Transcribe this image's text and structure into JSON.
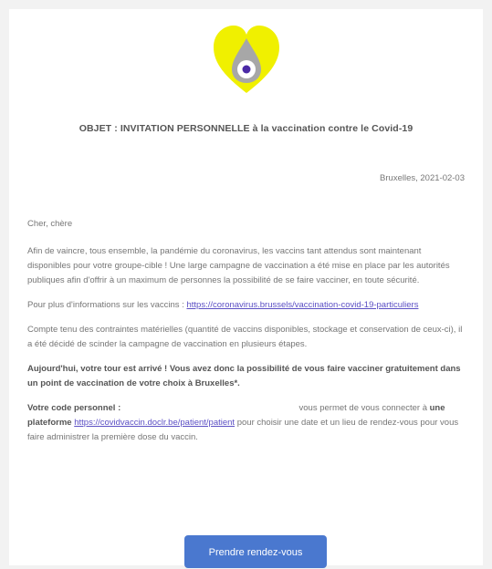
{
  "email": {
    "subject": "OBJET : INVITATION PERSONNELLE à la vaccination contre le Covid-19",
    "date": "Bruxelles, 2021-02-03",
    "greeting": "Cher, chère",
    "paragraph1": "Afin de vaincre, tous ensemble, la pandémie du coronavirus, les vaccins tant attendus sont maintenant disponibles pour votre groupe-cible ! Une large campagne de vaccination a été mise en place par les autorités publiques afin d'offrir à un maximum de personnes la possibilité de se faire vacciner, en toute sécurité.",
    "info_prefix": "Pour plus d'informations sur les vaccins :",
    "info_link": "https://coronavirus.brussels/vaccination-covid-19-particuliers",
    "paragraph3": "Compte tenu des contraintes matérielles (quantité de vaccins disponibles, stockage et conservation de ceux-ci), il a été décidé de scinder la campagne de vaccination en plusieurs étapes.",
    "paragraph4": "Aujourd'hui, votre tour est arrivé ! Vous avez donc la possibilité de vous faire vacciner gratuitement dans un point de vaccination de votre choix à Bruxelles*.",
    "code_label": "Votre code personnel :",
    "code_suffix": "vous permet de vous connecter à",
    "platform_label": "une plateforme",
    "platform_link": "https://covidvaccin.doclr.be/patient/patient",
    "platform_suffix": "pour choisir une date et un lieu de rendez-vous pour vous faire administrer la première dose du vaccin.",
    "cta_label": "Prendre rendez-vous"
  },
  "colors": {
    "logo_yellow": "#f0f000",
    "logo_grey": "#a7a7a7",
    "logo_purple": "#4b2aa6",
    "button": "#4a78cf",
    "link": "#5b4fc4"
  }
}
